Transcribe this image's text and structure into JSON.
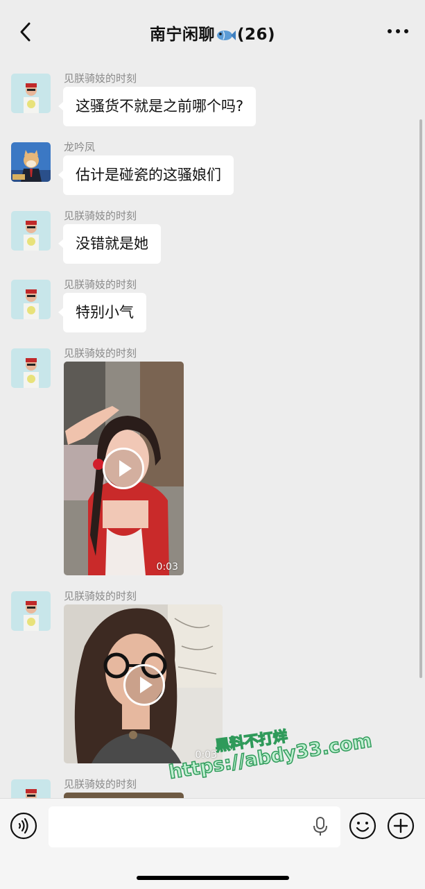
{
  "header": {
    "title_prefix": "南宁闲聊",
    "title_suffix": "(26)"
  },
  "messages": [
    {
      "sender": "见朕骑妓的时刻",
      "text": "这骚货不就是之前哪个吗?"
    },
    {
      "sender": "龙吟凤",
      "text": "估计是碰瓷的这骚娘们"
    },
    {
      "sender": "见朕骑妓的时刻",
      "text": "没错就是她"
    },
    {
      "sender": "见朕骑妓的时刻",
      "text": "特别小气"
    },
    {
      "sender": "见朕骑妓的时刻",
      "video_duration": "0:03"
    },
    {
      "sender": "见朕骑妓的时刻",
      "video_duration": "0:03"
    },
    {
      "sender": "见朕骑妓的时刻"
    }
  ],
  "watermark": {
    "line1": "黑料不打烊",
    "line2": "https://abdy33.com"
  },
  "input": {
    "value": ""
  },
  "colors": {
    "background": "#ededed",
    "bubble": "#ffffff",
    "watermark_fill": "#bff0d0",
    "watermark_stroke": "#2f9a5a"
  }
}
